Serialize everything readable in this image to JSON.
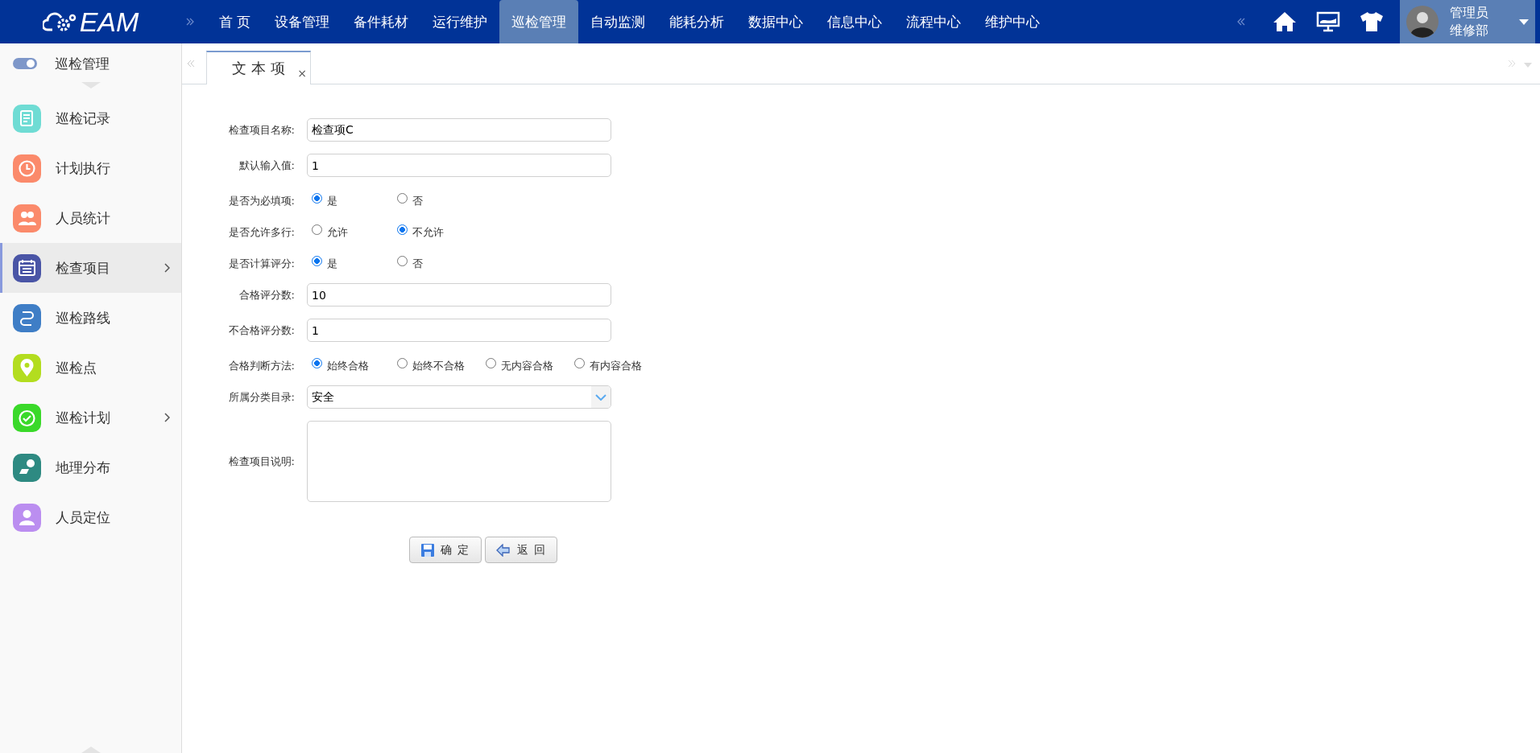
{
  "top_nav": {
    "logo": "EAM",
    "menu": [
      {
        "label": "首 页",
        "selected": false
      },
      {
        "label": "设备管理",
        "selected": false
      },
      {
        "label": "备件耗材",
        "selected": false
      },
      {
        "label": "运行维护",
        "selected": false
      },
      {
        "label": "巡检管理",
        "selected": true
      },
      {
        "label": "自动监测",
        "selected": false
      },
      {
        "label": "能耗分析",
        "selected": false
      },
      {
        "label": "数据中心",
        "selected": false
      },
      {
        "label": "信息中心",
        "selected": false
      },
      {
        "label": "流程中心",
        "selected": false
      },
      {
        "label": "维护中心",
        "selected": false
      }
    ],
    "user": {
      "name": "管理员",
      "dept": "维修部"
    }
  },
  "sidebar": {
    "title": "巡检管理",
    "items": [
      {
        "label": "巡检记录",
        "color": "#6fdcd4",
        "selected": false,
        "expandable": false
      },
      {
        "label": "计划执行",
        "color": "#fb8a6b",
        "selected": false,
        "expandable": false
      },
      {
        "label": "人员统计",
        "color": "#fb8a6b",
        "selected": false,
        "expandable": false
      },
      {
        "label": "检查项目",
        "color": "#4a55a6",
        "selected": true,
        "expandable": true
      },
      {
        "label": "巡检路线",
        "color": "#3f7ec6",
        "selected": false,
        "expandable": false
      },
      {
        "label": "巡检点",
        "color": "#b3dd1f",
        "selected": false,
        "expandable": false
      },
      {
        "label": "巡检计划",
        "color": "#3ad92a",
        "selected": false,
        "expandable": true
      },
      {
        "label": "地理分布",
        "color": "#2e8a82",
        "selected": false,
        "expandable": false
      },
      {
        "label": "人员定位",
        "color": "#bb8ef0",
        "selected": false,
        "expandable": false
      }
    ]
  },
  "tabs": [
    {
      "label": "文 本 项",
      "selected": true,
      "close": "×"
    }
  ],
  "form": {
    "fields": [
      {
        "kind": "text",
        "label": "检查项目名称:",
        "value": "检查项C"
      },
      {
        "kind": "text",
        "label": "默认输入值:",
        "value": "1"
      },
      {
        "kind": "radio",
        "label": "是否为必填项:",
        "options": [
          {
            "label": "是",
            "selected": true
          },
          {
            "label": "否",
            "selected": false
          }
        ]
      },
      {
        "kind": "radio",
        "label": "是否允许多行:",
        "options": [
          {
            "label": "允许",
            "selected": false
          },
          {
            "label": "不允许",
            "selected": true
          }
        ]
      },
      {
        "kind": "radio",
        "label": "是否计算评分:",
        "options": [
          {
            "label": "是",
            "selected": true
          },
          {
            "label": "否",
            "selected": false
          }
        ]
      },
      {
        "kind": "text",
        "label": "合格评分数:",
        "value": "10"
      },
      {
        "kind": "text",
        "label": "不合格评分数:",
        "value": "1"
      },
      {
        "kind": "radio",
        "label": "合格判断方法:",
        "options": [
          {
            "label": "始终合格",
            "selected": true
          },
          {
            "label": "始终不合格",
            "selected": false
          },
          {
            "label": "无内容合格",
            "selected": false
          },
          {
            "label": "有内容合格",
            "selected": false
          }
        ]
      },
      {
        "kind": "select",
        "label": "所属分类目录:",
        "value": "安全"
      },
      {
        "kind": "textarea",
        "label": "检查项目说明:"
      }
    ],
    "buttons": [
      {
        "kind": "save",
        "label": "确 定"
      },
      {
        "kind": "back",
        "label": "返 回"
      }
    ]
  }
}
